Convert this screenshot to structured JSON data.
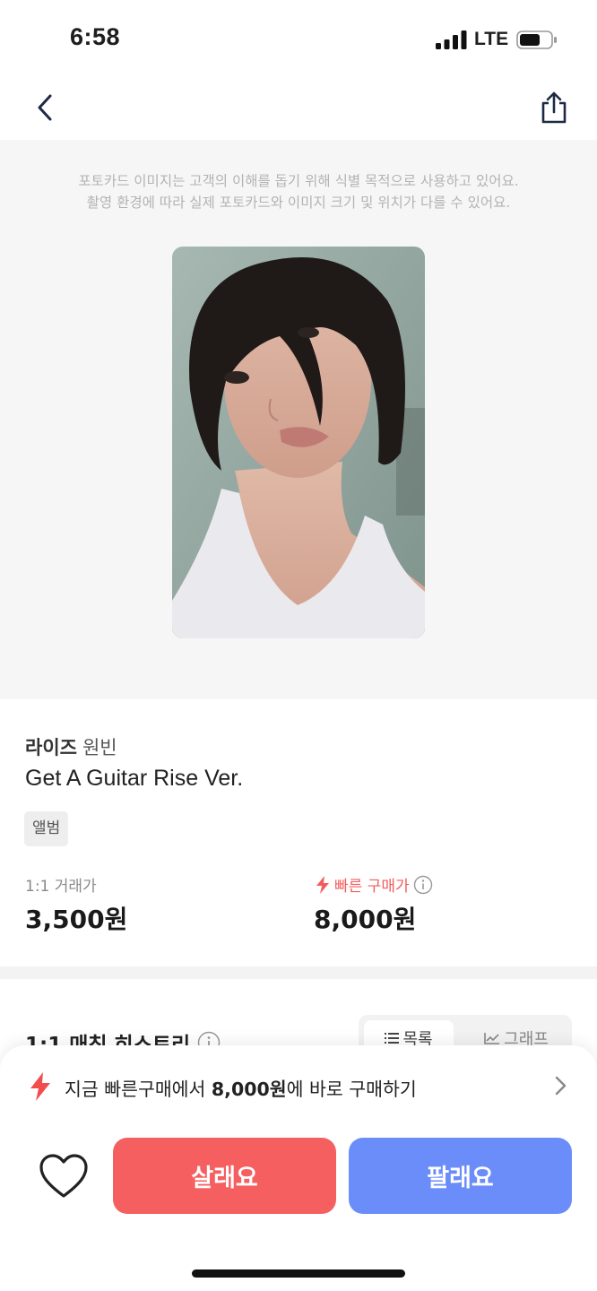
{
  "status_bar": {
    "time": "6:58",
    "network": "LTE"
  },
  "nav": {
    "back_icon": "chevron-left-icon",
    "share_icon": "share-icon"
  },
  "image_notice": {
    "line1": "포토카드 이미지는 고객의 이해를 돕기 위해 식별 목적으로 사용하고 있어요.",
    "line2": "촬영 환경에 따라 실제 포토카드와 이미지 크기 및 위치가 다를 수 있어요."
  },
  "product": {
    "group": "라이즈",
    "member": "원빈",
    "album_title": "Get A Guitar Rise Ver.",
    "tag": "앨범",
    "one_to_one_label": "1:1 거래가",
    "one_to_one_price": "3,500원",
    "quick_buy_label": "빠른 구매가",
    "quick_buy_price": "8,000원"
  },
  "history": {
    "title": "1:1 매칭 히스토리",
    "toggle_list": "목록",
    "toggle_graph": "그래프"
  },
  "bottom_sheet": {
    "quick_buy_prefix": "지금 빠른구매에서 ",
    "quick_buy_amount": "8,000원",
    "quick_buy_suffix": "에 바로 구매하기",
    "buy_label": "살래요",
    "sell_label": "팔래요"
  },
  "colors": {
    "buy": "#f65f5f",
    "sell": "#6b8dfa",
    "accent_red": "#f25c5c"
  }
}
